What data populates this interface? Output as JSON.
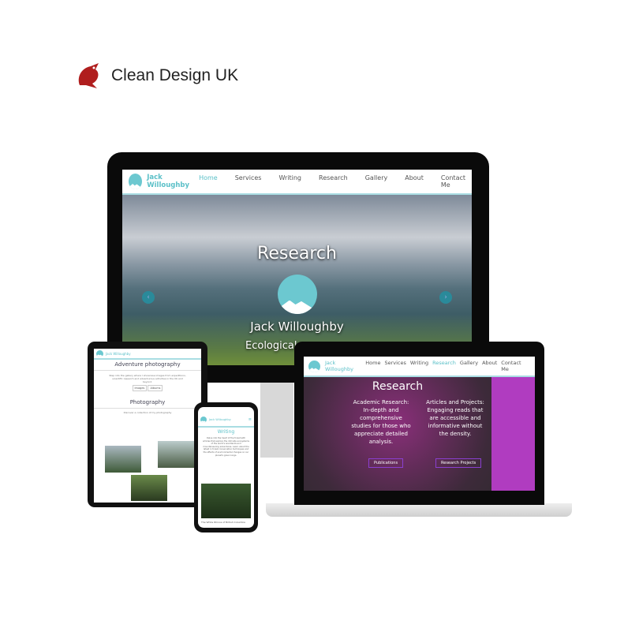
{
  "brand": {
    "name": "Clean Design UK",
    "logo_icon": "red-dragon-icon"
  },
  "site": {
    "name": "Jack Willoughby",
    "nav": [
      "Home",
      "Services",
      "Writing",
      "Research",
      "Gallery",
      "About",
      "Contact Me"
    ]
  },
  "monitor": {
    "active": "Home",
    "hero_title": "Research",
    "hero_name": "Jack Willoughby",
    "hero_subtitle": "Ecological"
  },
  "laptop": {
    "active": "Research",
    "title": "Research",
    "col1": "Academic Research: In-depth and comprehensive studies for those who appreciate detailed analysis.",
    "col2": "Articles and Projects: Engaging reads that are accessible and informative without the density.",
    "btn1": "Publications",
    "btn2": "Research Projects"
  },
  "tablet": {
    "heading": "Adventure photography",
    "intro": "Step into the gallery where I showcase images from expeditions, scientific research and adventurous activities in the UK and beyond.",
    "btn1": "Images",
    "btn2": "Albums",
    "section": "Photography",
    "section_text": "Discover a collection of my photography"
  },
  "phone": {
    "heading": "Writing",
    "text": "Delve into the heart of the forest with articles that explore the intricate ecosystems of the world's woodlands and mountaineering adventures. Learn about the latest in forest conservation techniques and the effects of environmental changes on our planet's green lungs.",
    "caption": "The White Rhinos of British Columbia"
  }
}
